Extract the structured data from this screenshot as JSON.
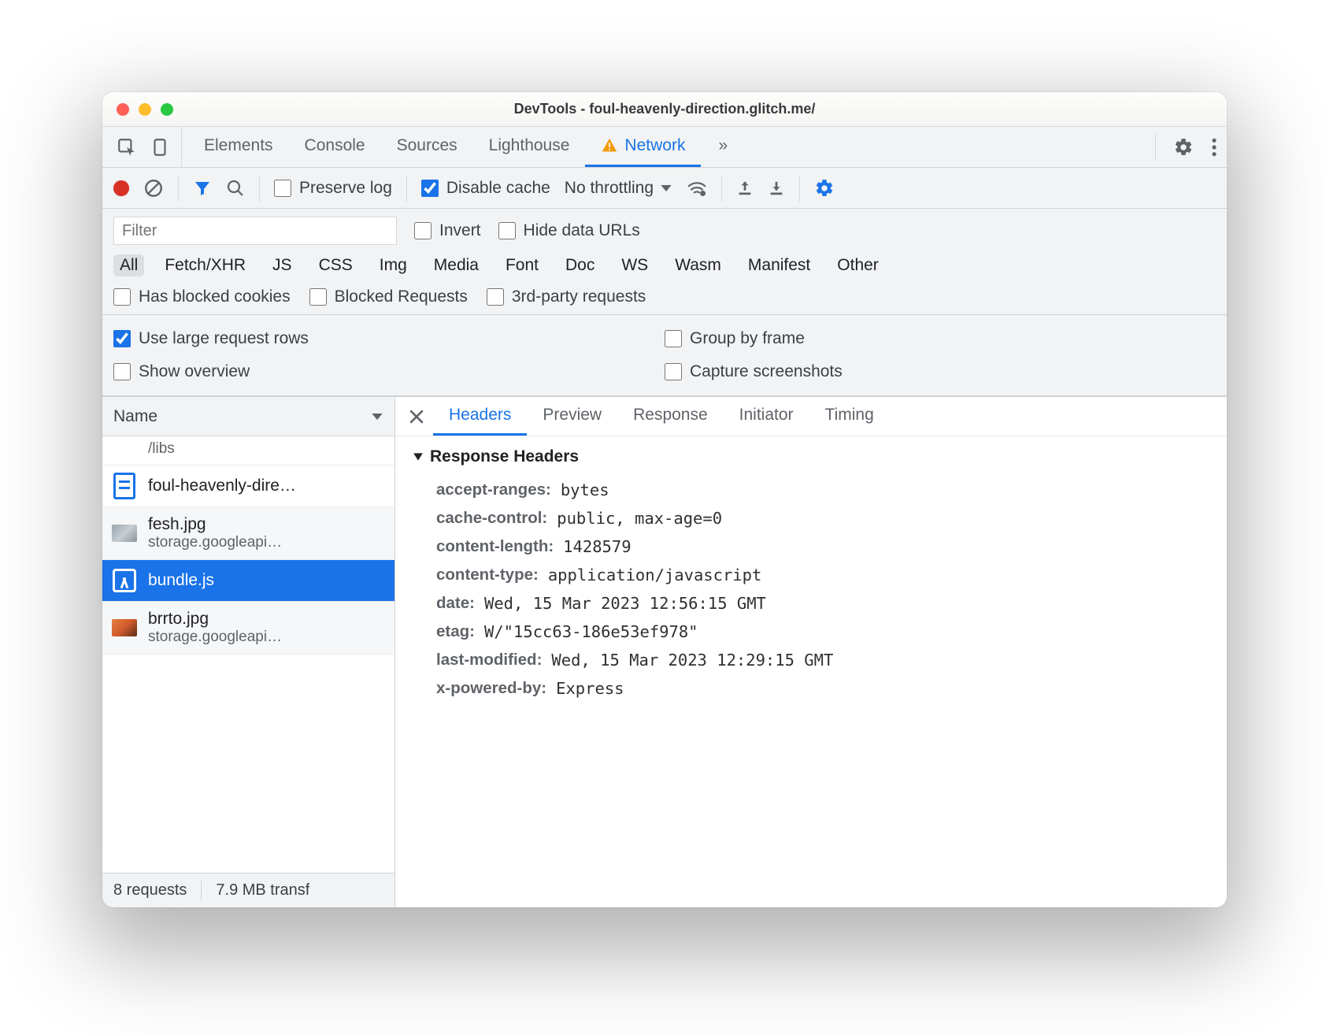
{
  "window": {
    "title": "DevTools - foul-heavenly-direction.glitch.me/"
  },
  "mainTabs": {
    "items": [
      "Elements",
      "Console",
      "Sources",
      "Lighthouse",
      "Network"
    ],
    "active": "Network",
    "overflow_glyph": "»"
  },
  "toolbar": {
    "preserve_log": {
      "label": "Preserve log",
      "checked": false
    },
    "disable_cache": {
      "label": "Disable cache",
      "checked": true
    },
    "throttling": {
      "label": "No throttling"
    }
  },
  "filter": {
    "placeholder": "Filter",
    "value": "",
    "invert": {
      "label": "Invert",
      "checked": false
    },
    "hide_data_urls": {
      "label": "Hide data URLs",
      "checked": false
    },
    "types": [
      "All",
      "Fetch/XHR",
      "JS",
      "CSS",
      "Img",
      "Media",
      "Font",
      "Doc",
      "WS",
      "Wasm",
      "Manifest",
      "Other"
    ],
    "active_type": "All",
    "has_blocked_cookies": {
      "label": "Has blocked cookies",
      "checked": false
    },
    "blocked_requests": {
      "label": "Blocked Requests",
      "checked": false
    },
    "third_party": {
      "label": "3rd-party requests",
      "checked": false
    }
  },
  "view": {
    "large_rows": {
      "label": "Use large request rows",
      "checked": true
    },
    "group_frame": {
      "label": "Group by frame",
      "checked": false
    },
    "overview": {
      "label": "Show overview",
      "checked": false
    },
    "screenshots": {
      "label": "Capture screenshots",
      "checked": false
    }
  },
  "columns": {
    "name": "Name"
  },
  "requests": [
    {
      "icon": "file-cut",
      "name": "/libs",
      "sub": "",
      "cut": true
    },
    {
      "icon": "doc",
      "name": "foul-heavenly-dire…",
      "sub": ""
    },
    {
      "icon": "thumb",
      "name": "fesh.jpg",
      "sub": "storage.googleapi…",
      "alt": true
    },
    {
      "icon": "js",
      "name": "bundle.js",
      "sub": "",
      "selected": true
    },
    {
      "icon": "thumb-warm",
      "name": "brrto.jpg",
      "sub": "storage.googleapi…",
      "alt": true
    }
  ],
  "status": {
    "requests": "8 requests",
    "transfer": "7.9 MB transf"
  },
  "detailTabs": {
    "items": [
      "Headers",
      "Preview",
      "Response",
      "Initiator",
      "Timing"
    ],
    "active": "Headers"
  },
  "headers": {
    "section": "Response Headers",
    "kv": [
      {
        "k": "accept-ranges:",
        "v": "bytes"
      },
      {
        "k": "cache-control:",
        "v": "public, max-age=0"
      },
      {
        "k": "content-length:",
        "v": "1428579"
      },
      {
        "k": "content-type:",
        "v": "application/javascript"
      },
      {
        "k": "date:",
        "v": "Wed, 15 Mar 2023 12:56:15 GMT"
      },
      {
        "k": "etag:",
        "v": "W/\"15cc63-186e53ef978\""
      },
      {
        "k": "last-modified:",
        "v": "Wed, 15 Mar 2023 12:29:15 GMT"
      },
      {
        "k": "x-powered-by:",
        "v": "Express"
      }
    ]
  }
}
